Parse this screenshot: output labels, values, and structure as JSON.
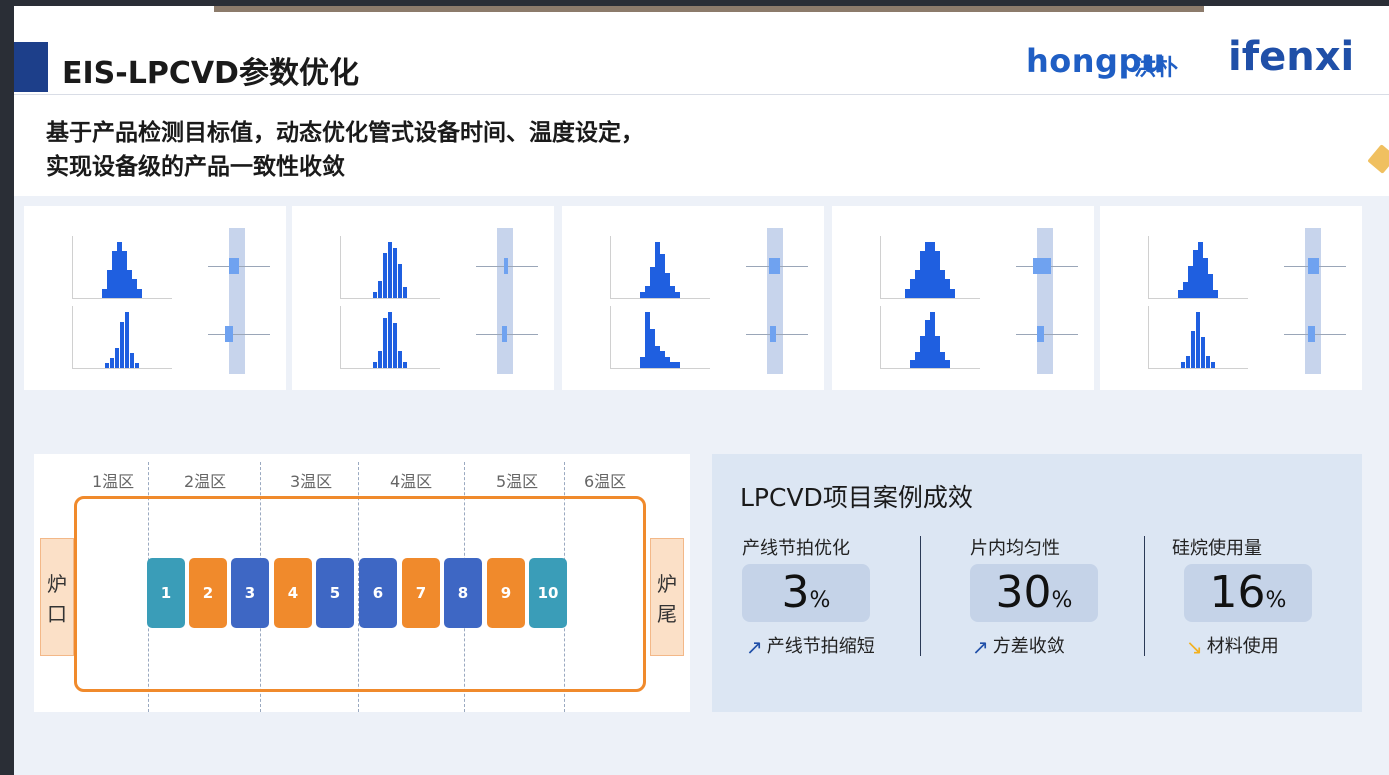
{
  "header": {
    "title": "EIS-LPCVD参数优化",
    "logo_hongpu": "hongpu",
    "logo_hongpu_cn": "洪朴",
    "logo_ifenxi": "ifenxi"
  },
  "subtitle": {
    "line1": "基于产品检测目标值，动态优化管式设备时间、温度设定，",
    "line2": "实现设备级的产品一致性收敛"
  },
  "colors": {
    "accent_blue": "#1f5fe0",
    "brand_blue": "#1f5ec4",
    "orange": "#f08a2c",
    "teal": "#3a9db8",
    "slot_blue": "#3e67c4"
  },
  "chart_data": [
    {
      "type": "bar",
      "top_hist": [
        1,
        3,
        5,
        6,
        5,
        3,
        2,
        1
      ],
      "bottom_hist": [
        1,
        2,
        4,
        9,
        11,
        3,
        1
      ],
      "box_top": [
        0.35,
        0.5
      ],
      "box_bottom": [
        0.3,
        0.42
      ]
    },
    {
      "type": "bar",
      "top_hist": [
        1,
        3,
        8,
        10,
        9,
        6,
        2
      ],
      "bottom_hist": [
        1,
        3,
        9,
        10,
        8,
        3,
        1
      ],
      "box_top": [
        0.45,
        0.52
      ],
      "box_bottom": [
        0.43,
        0.5
      ]
    },
    {
      "type": "bar",
      "top_hist": [
        1,
        2,
        5,
        9,
        7,
        4,
        2,
        1
      ],
      "bottom_hist": [
        2,
        10,
        7,
        4,
        3,
        2,
        1,
        1
      ],
      "box_top": [
        0.38,
        0.55
      ],
      "box_bottom": [
        0.4,
        0.48
      ]
    },
    {
      "type": "bar",
      "top_hist": [
        1,
        2,
        3,
        5,
        6,
        6,
        5,
        3,
        2,
        1
      ],
      "bottom_hist": [
        1,
        2,
        4,
        6,
        7,
        4,
        2,
        1
      ],
      "box_top": [
        0.3,
        0.55
      ],
      "box_bottom": [
        0.35,
        0.45
      ]
    },
    {
      "type": "bar",
      "top_hist": [
        1,
        2,
        4,
        6,
        7,
        5,
        3,
        1
      ],
      "bottom_hist": [
        1,
        2,
        6,
        9,
        5,
        2,
        1
      ],
      "box_top": [
        0.4,
        0.55
      ],
      "box_bottom": [
        0.4,
        0.5
      ]
    }
  ],
  "furnace": {
    "zones": [
      "1温区",
      "2温区",
      "3温区",
      "4温区",
      "5温区",
      "6温区"
    ],
    "inlet": "炉口",
    "tail": "炉尾",
    "slots": [
      {
        "label": "1",
        "color": "#3a9db8"
      },
      {
        "label": "2",
        "color": "#f08a2c"
      },
      {
        "label": "3",
        "color": "#3e67c4"
      },
      {
        "label": "4",
        "color": "#f08a2c"
      },
      {
        "label": "5",
        "color": "#3e67c4"
      },
      {
        "label": "6",
        "color": "#3e67c4"
      },
      {
        "label": "7",
        "color": "#f08a2c"
      },
      {
        "label": "8",
        "color": "#3e67c4"
      },
      {
        "label": "9",
        "color": "#f08a2c"
      },
      {
        "label": "10",
        "color": "#3a9db8"
      }
    ]
  },
  "results": {
    "title": "LPCVD项目案例成效",
    "metrics": [
      {
        "label": "产线节拍优化",
        "value": "3",
        "unit": "%",
        "note": "产线节拍缩短",
        "arrow_icon": "up-right-arrow-icon",
        "arrow_color": "#1f4fa8"
      },
      {
        "label": "片内均匀性",
        "value": "30",
        "unit": "%",
        "note": "方差收敛",
        "arrow_icon": "up-right-arrow-icon",
        "arrow_color": "#1f4fa8"
      },
      {
        "label": "硅烷使用量",
        "value": "16",
        "unit": "%",
        "note": "材料使用",
        "arrow_icon": "down-right-arrow-icon",
        "arrow_color": "#f2b01e"
      }
    ]
  }
}
